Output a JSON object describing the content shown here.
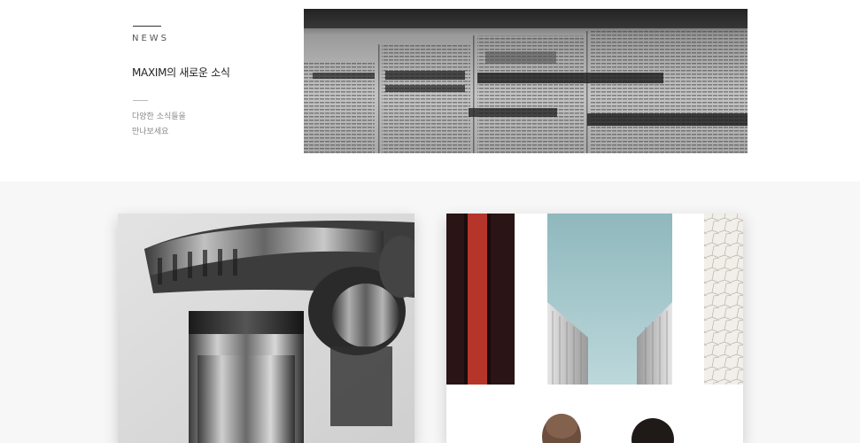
{
  "news": {
    "label": "NEWS",
    "title": "MAXIM의 새로운 소식",
    "desc_line1": "다양한 소식들을",
    "desc_line2": "만나보세요"
  },
  "images": {
    "newspaper": "newspaper-photo",
    "microscope": "microscope-photo",
    "art_gallery": "art-gallery-photo"
  },
  "colors": {
    "gallery_bg": "#f7f7f7",
    "text_dark": "#222222",
    "text_muted": "#888888"
  }
}
